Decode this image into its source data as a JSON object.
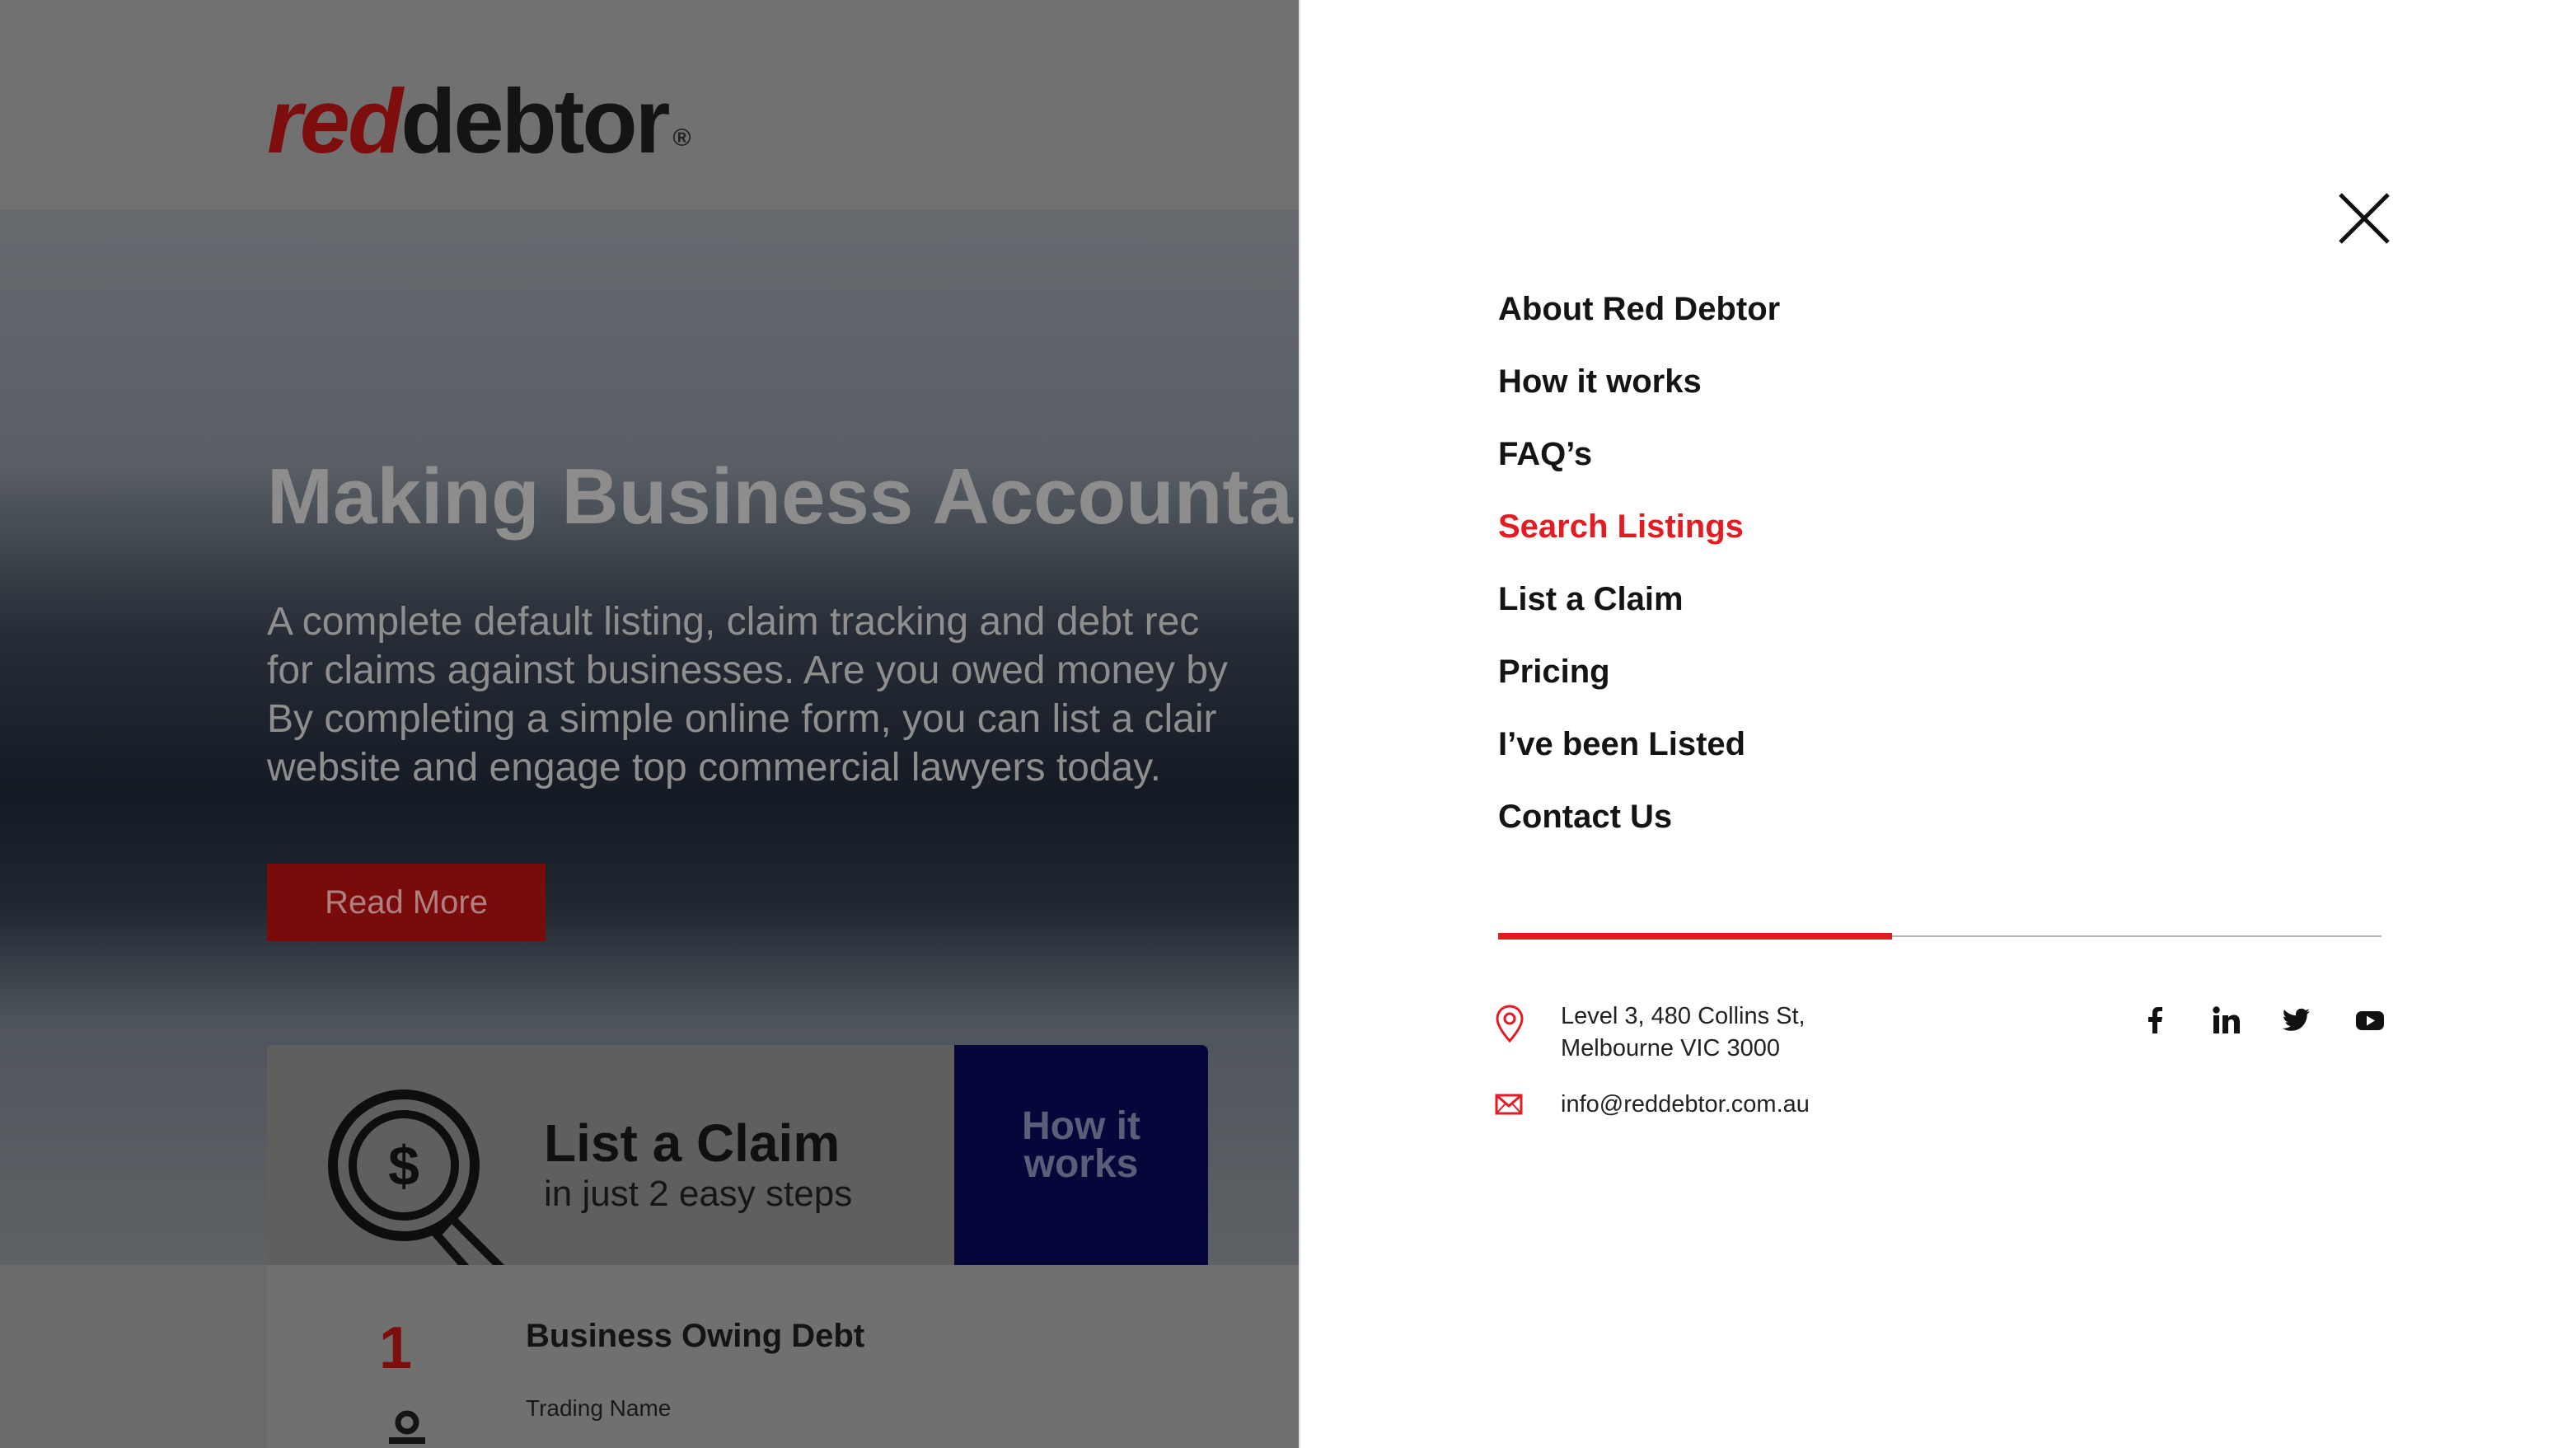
{
  "background": {
    "logo": {
      "red": "red",
      "dark": "debtor",
      "mark": "®"
    },
    "hero": {
      "title": "Making Business Accounta",
      "text": "A complete default listing, claim tracking and debt rec\nfor claims against businesses. Are you owed money by\nBy completing a simple online form, you can list a clair\nwebsite and engage top commercial lawyers today.",
      "button_label": "Read More"
    },
    "claim_card": {
      "title": "List a Claim",
      "subtitle": "in just 2 easy steps",
      "how_it_works": "How it\nworks"
    },
    "form_card": {
      "step_number": "1",
      "step_title": "Business Owing Debt",
      "field_label": "Trading Name"
    }
  },
  "menu": {
    "items": [
      {
        "label": "About Red Debtor",
        "active": false
      },
      {
        "label": "How it works",
        "active": false
      },
      {
        "label": "FAQ’s",
        "active": false
      },
      {
        "label": "Search Listings",
        "active": true
      },
      {
        "label": "List a Claim",
        "active": false
      },
      {
        "label": "Pricing",
        "active": false
      },
      {
        "label": "I’ve been Listed",
        "active": false
      },
      {
        "label": "Contact Us",
        "active": false
      }
    ],
    "address": "Level 3, 480 Collins St,\nMelbourne VIC 3000",
    "email": "info@reddebtor.com.au",
    "social": [
      "facebook-icon",
      "linkedin-icon",
      "twitter-icon",
      "youtube-icon"
    ]
  },
  "colors": {
    "accent": "#e31b23",
    "text": "#141414",
    "overlay": "#6a6a6a",
    "how_box": "#05063a"
  }
}
